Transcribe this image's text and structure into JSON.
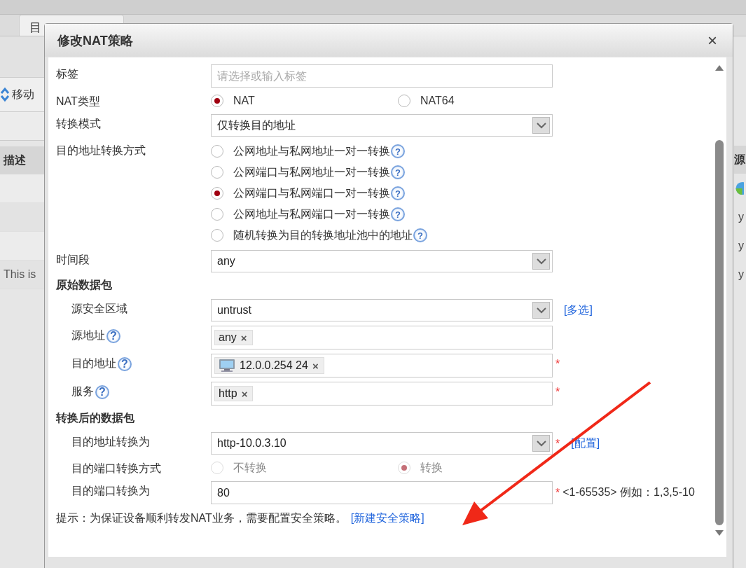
{
  "background": {
    "tabs": [
      {
        "label": "目",
        "selected": false
      }
    ],
    "toolbar": {
      "move_button": "移动"
    },
    "table": {
      "columns": [
        "描述"
      ],
      "rows": [
        {
          "column_1": ""
        },
        {
          "column_1": ""
        },
        {
          "column_1": ""
        },
        {
          "column_1": "This is"
        }
      ]
    },
    "right_column": {
      "header": "源",
      "cells": [
        "y",
        "y",
        "y"
      ]
    }
  },
  "dialog": {
    "title": "修改NAT策略",
    "close": "×",
    "rows": [
      {
        "kind": "input",
        "label": "标签",
        "placeholder": "请选择或输入标签"
      },
      {
        "kind": "radios_inline",
        "label": "NAT类型",
        "disabled": false,
        "options": [
          {
            "label": "NAT",
            "selected": true
          },
          {
            "label": "NAT64",
            "selected": false
          }
        ]
      },
      {
        "kind": "select",
        "label": "转换模式",
        "value": "仅转换目的地址"
      },
      {
        "kind": "radios",
        "label": "目的地址转换方式",
        "options": [
          {
            "label": "公网地址与私网地址一对一转换",
            "selected": false,
            "help": "?"
          },
          {
            "label": "公网端口与私网地址一对一转换",
            "selected": false,
            "help": "?"
          },
          {
            "label": "公网端口与私网端口一对一转换",
            "selected": true,
            "help": "?"
          },
          {
            "label": "公网地址与私网端口一对一转换",
            "selected": false,
            "help": "?"
          },
          {
            "label": "随机转换为目的转换地址池中的地址",
            "selected": false,
            "help": "?"
          }
        ]
      },
      {
        "kind": "select",
        "label": "时间段",
        "value": "any"
      },
      {
        "kind": "section",
        "label": "原始数据包",
        "children": [
          {
            "kind": "select",
            "label": "源安全区域",
            "value": "untrust",
            "link": "[多选]"
          },
          {
            "kind": "tags",
            "label": "源地址",
            "help": "?",
            "tags": [
              {
                "kind": "plain",
                "text": "any",
                "remove": "×"
              }
            ]
          },
          {
            "kind": "tags",
            "label": "目的地址",
            "help": "?",
            "required_mark": "*",
            "tags": [
              {
                "kind": "host",
                "text": "12.0.0.254 24",
                "remove": "×"
              }
            ]
          },
          {
            "kind": "tags",
            "label": "服务",
            "help": "?",
            "required_mark": "*",
            "tags": [
              {
                "kind": "plain",
                "text": "http",
                "remove": "×"
              }
            ]
          }
        ]
      },
      {
        "kind": "section",
        "label": "转换后的数据包",
        "children": [
          {
            "kind": "select",
            "label": "目的地址转换为",
            "value": "http-10.0.3.10",
            "required_mark": "*",
            "link": "[配置]"
          },
          {
            "kind": "radios_inline",
            "label": "目的端口转换方式",
            "disabled": true,
            "options": [
              {
                "label": "不转换",
                "selected": false
              },
              {
                "label": "转换",
                "selected": true
              }
            ]
          },
          {
            "kind": "value_input",
            "label": "目的端口转换为",
            "value": "80",
            "required_mark": "*",
            "note": "<1-65535> 例如：1,3,5-10"
          }
        ]
      }
    ],
    "hint": {
      "text": "提示：为保证设备顺利转发NAT业务，需要配置安全策略。",
      "link": "[新建安全策略]"
    }
  }
}
